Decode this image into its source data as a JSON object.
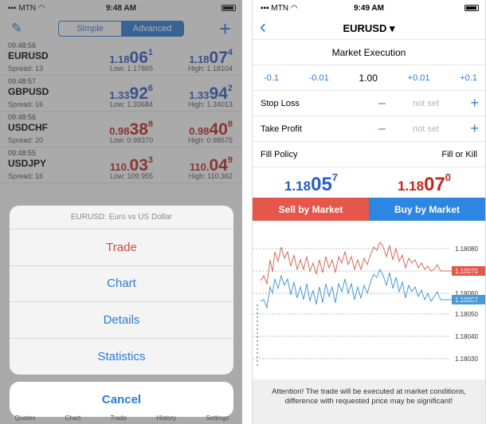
{
  "colors": {
    "accent": "#2c7cd6",
    "sell": "#e4574a",
    "buy": "#2d86e2",
    "bid_blue": "#2c5bc7",
    "ask_red": "#c0281f"
  },
  "left": {
    "status": {
      "carrier": "MTN",
      "time": "9:48 AM"
    },
    "toolbar": {
      "edit_icon": "pencil-icon",
      "add_icon": "plus-icon",
      "seg_simple": "Simple",
      "seg_advanced": "Advanced"
    },
    "quotes": [
      {
        "time": "09:48:56",
        "symbol": "EURUSD",
        "spread": "Spread: 13",
        "bid_pre": "1.18",
        "bid_big": "06",
        "bid_sup": "1",
        "ask_pre": "1.18",
        "ask_big": "07",
        "ask_sup": "4",
        "low": "Low: 1.17865",
        "high": "High: 1.18104",
        "color": "blue"
      },
      {
        "time": "09:48:57",
        "symbol": "GBPUSD",
        "spread": "Spread: 16",
        "bid_pre": "1.33",
        "bid_big": "92",
        "bid_sup": "6",
        "ask_pre": "1.33",
        "ask_big": "94",
        "ask_sup": "2",
        "low": "Low: 1.33684",
        "high": "High: 1.34013",
        "color": "blue"
      },
      {
        "time": "09:48:56",
        "symbol": "USDCHF",
        "spread": "Spread: 20",
        "bid_pre": "0.98",
        "bid_big": "38",
        "bid_sup": "8",
        "ask_pre": "0.98",
        "ask_big": "40",
        "ask_sup": "8",
        "low": "Low: 0.98370",
        "high": "High: 0.98675",
        "color": "red"
      },
      {
        "time": "09:48:55",
        "symbol": "USDJPY",
        "spread": "Spread: 16",
        "bid_pre": "110.",
        "bid_big": "03",
        "bid_sup": "3",
        "ask_pre": "110.",
        "ask_big": "04",
        "ask_sup": "9",
        "low": "Low: 109.955",
        "high": "High: 110.362",
        "color": "red"
      }
    ],
    "sheet": {
      "title": "EURUSD: Euro vs US Dollar",
      "items": [
        "Trade",
        "Chart",
        "Details",
        "Statistics"
      ],
      "cancel": "Cancel"
    },
    "tabs": [
      "Quotes",
      "Chart",
      "Trade",
      "History",
      "Settings"
    ]
  },
  "right": {
    "status": {
      "carrier": "MTN",
      "time": "9:49 AM"
    },
    "title": "EURUSD ▾",
    "execution": "Market Execution",
    "volume": {
      "m1": "-0.1",
      "m2": "-0.01",
      "value": "1.00",
      "p1": "+0.01",
      "p2": "+0.1"
    },
    "stop_loss": {
      "label": "Stop Loss",
      "value": "not set"
    },
    "take_profit": {
      "label": "Take Profit",
      "value": "not set"
    },
    "fill_policy": {
      "label": "Fill Policy",
      "value": "Fill or Kill"
    },
    "bid": {
      "pre": "1.18",
      "big": "05",
      "sup": "7"
    },
    "ask": {
      "pre": "1.18",
      "big": "07",
      "sup": "0"
    },
    "sell_label": "Sell by Market",
    "buy_label": "Buy by Market",
    "chart_levels": [
      "1.18080",
      "1.18070",
      "1.18060",
      "1.18057",
      "1.18050",
      "1.18040",
      "1.18030"
    ],
    "attention": "Attention! The trade will be executed at market conditions, difference with requested price may be significant!"
  }
}
